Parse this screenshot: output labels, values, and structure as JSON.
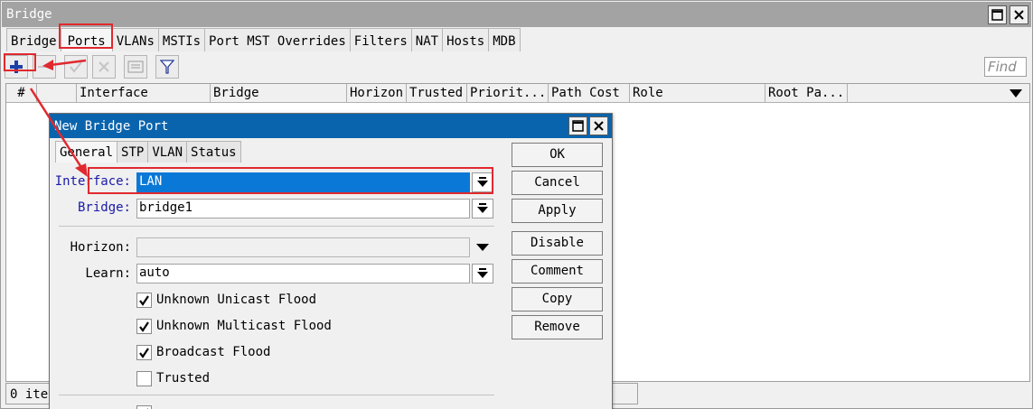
{
  "window": {
    "title": "Bridge"
  },
  "tabs": [
    "Bridge",
    "Ports",
    "VLANs",
    "MSTIs",
    "Port MST Overrides",
    "Filters",
    "NAT",
    "Hosts",
    "MDB"
  ],
  "toolbar": {
    "find_placeholder": "Find"
  },
  "grid": {
    "columns": [
      "#",
      "",
      "Interface",
      "Bridge",
      "Horizon",
      "Trusted",
      "Priorit...",
      "Path Cost",
      "Role",
      "Root Pa..."
    ]
  },
  "status": {
    "text": "0 ite"
  },
  "dialog": {
    "title": "New Bridge Port",
    "tabs": [
      "General",
      "STP",
      "VLAN",
      "Status"
    ],
    "interface": {
      "label": "Interface:",
      "value": "LAN"
    },
    "bridge": {
      "label": "Bridge:",
      "value": "bridge1"
    },
    "horizon": {
      "label": "Horizon:",
      "value": ""
    },
    "learn": {
      "label": "Learn:",
      "value": "auto"
    },
    "checkboxes": [
      {
        "label": "Unknown Unicast Flood",
        "checked": true
      },
      {
        "label": "Unknown Multicast Flood",
        "checked": true
      },
      {
        "label": "Broadcast Flood",
        "checked": true
      },
      {
        "label": "Trusted",
        "checked": false
      }
    ],
    "buttons": [
      "OK",
      "Cancel",
      "Apply",
      "Disable",
      "Comment",
      "Copy",
      "Remove"
    ]
  },
  "colors": {
    "highlight": "#e0292e",
    "selection": "#0a78d7",
    "dialog_title": "#0a64ad",
    "label_blue": "#1a1aa8"
  }
}
